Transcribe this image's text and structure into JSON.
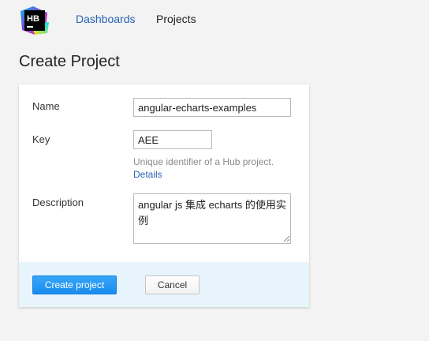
{
  "header": {
    "logo_text": "HB",
    "nav": [
      {
        "label": "Dashboards"
      },
      {
        "label": "Projects"
      }
    ]
  },
  "page": {
    "title": "Create Project"
  },
  "form": {
    "name": {
      "label": "Name",
      "value": "angular-echarts-examples"
    },
    "key": {
      "label": "Key",
      "value": "AEE",
      "hint": "Unique identifier of a Hub project.",
      "hint_link": "Details"
    },
    "description": {
      "label": "Description",
      "value": "angular js 集成 echarts 的使用实例"
    }
  },
  "actions": {
    "create_label": "Create project",
    "cancel_label": "Cancel"
  },
  "colors": {
    "link": "#2663b4",
    "primary_button": "#1a8cf0",
    "footer_bg": "#e7f4fc",
    "page_bg": "#f3f3f3"
  }
}
